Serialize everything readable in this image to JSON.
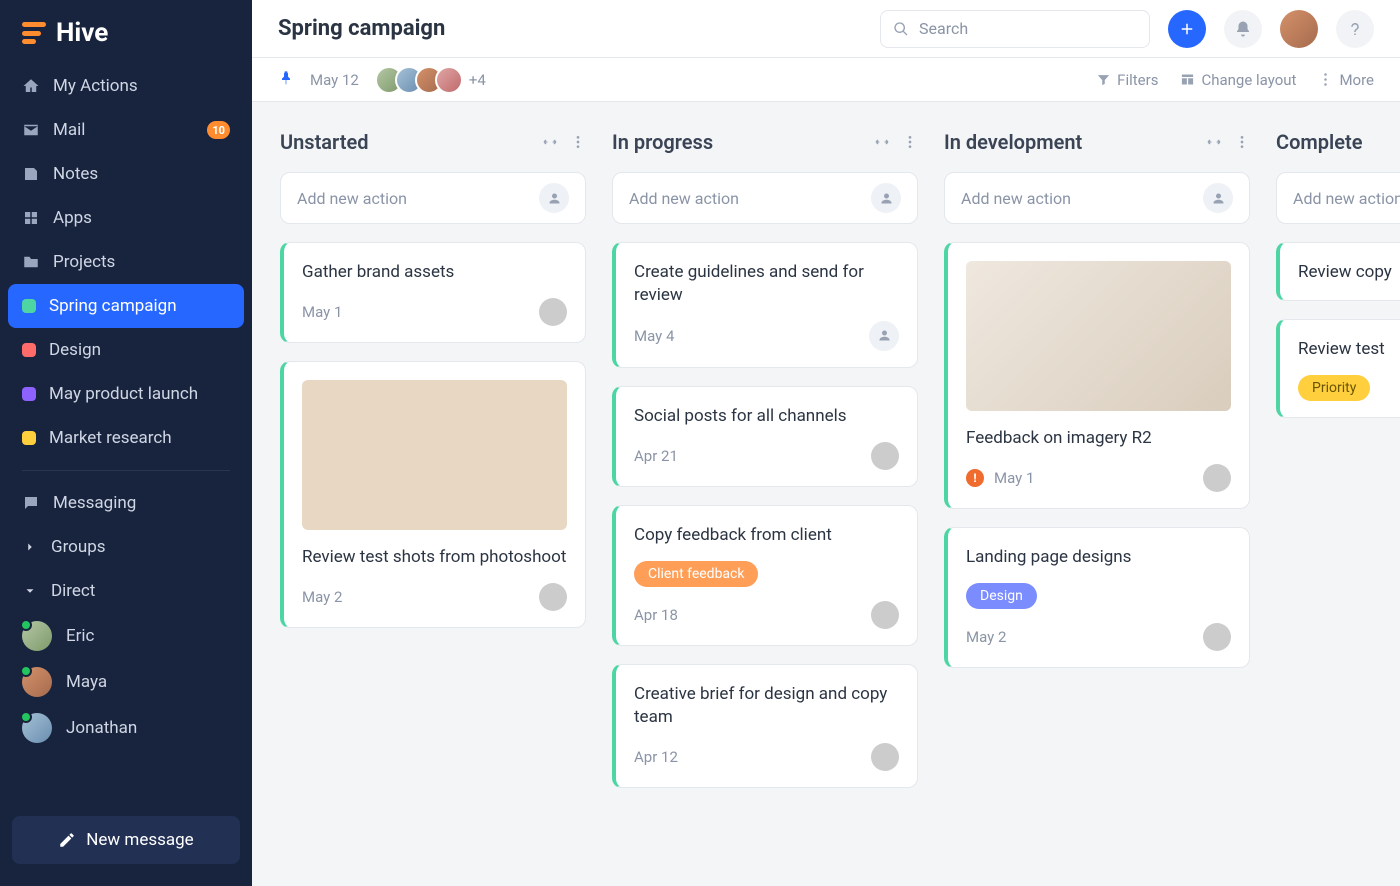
{
  "app": {
    "name": "Hive"
  },
  "sidebar": {
    "items": [
      {
        "label": "My Actions",
        "icon": "home"
      },
      {
        "label": "Mail",
        "icon": "mail",
        "badge": "10"
      },
      {
        "label": "Notes",
        "icon": "note"
      },
      {
        "label": "Apps",
        "icon": "apps"
      },
      {
        "label": "Projects",
        "icon": "folder"
      }
    ],
    "projects": [
      {
        "label": "Spring campaign",
        "color": "#4dd6a3",
        "active": true
      },
      {
        "label": "Design",
        "color": "#ff6b6b"
      },
      {
        "label": "May product launch",
        "color": "#8d62ff"
      },
      {
        "label": "Market research",
        "color": "#ffcf3d"
      }
    ],
    "messaging_label": "Messaging",
    "groups_label": "Groups",
    "direct_label": "Direct",
    "dms": [
      {
        "name": "Eric"
      },
      {
        "name": "Maya"
      },
      {
        "name": "Jonathan"
      }
    ],
    "new_message": "New message"
  },
  "header": {
    "title": "Spring campaign",
    "search_placeholder": "Search"
  },
  "subbar": {
    "date": "May 12",
    "more_members": "+4",
    "filters_label": "Filters",
    "layout_label": "Change layout",
    "more_label": "More"
  },
  "board": {
    "add_placeholder": "Add new action",
    "columns": [
      {
        "title": "Unstarted",
        "cards": [
          {
            "title": "Gather brand assets",
            "date": "May 1",
            "avatar": "av-d"
          },
          {
            "image": true,
            "title": "Review test shots from photoshoot",
            "date": "May 2",
            "avatar": "av-a"
          }
        ]
      },
      {
        "title": "In progress",
        "cards": [
          {
            "title": "Create guidelines and send for review",
            "date": "May 4",
            "unassigned": true
          },
          {
            "title": "Social posts for all channels",
            "date": "Apr 21",
            "avatar": "av-e"
          },
          {
            "title": "Copy feedback from client",
            "tag": {
              "text": "Client feedback",
              "color": "orange"
            },
            "date": "Apr 18",
            "avatar": "av-e"
          },
          {
            "title": "Creative brief for design and copy team",
            "date": "Apr 12",
            "avatar": "av-e"
          }
        ]
      },
      {
        "title": "In development",
        "cards": [
          {
            "image": "flatlay",
            "title": "Feedback on imagery R2",
            "alert": true,
            "date": "May 1",
            "avatar": "av-c"
          },
          {
            "title": "Landing page designs",
            "tag": {
              "text": "Design",
              "color": "purple"
            },
            "date": "May 2",
            "avatar": "av-d"
          }
        ]
      },
      {
        "title": "Complete",
        "cards": [
          {
            "title": "Review copy"
          },
          {
            "title": "Review test",
            "tag": {
              "text": "Priority",
              "color": "yellow"
            }
          }
        ]
      }
    ]
  }
}
